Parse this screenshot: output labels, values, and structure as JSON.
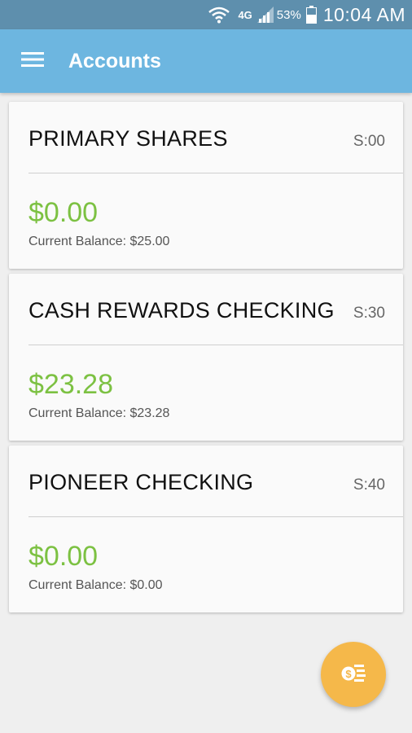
{
  "status_bar": {
    "network": "4G",
    "battery_percent": "53%",
    "time": "10:04 AM"
  },
  "app_bar": {
    "title": "Accounts",
    "menu_icon": "menu-icon",
    "color": "#6db6e0"
  },
  "accounts": [
    {
      "name": "PRIMARY SHARES",
      "suffix": "S:00",
      "available": "$0.00",
      "current_balance": "Current Balance: $25.00"
    },
    {
      "name": "CASH REWARDS CHECKING",
      "suffix": "S:30",
      "available": "$23.28",
      "current_balance": "Current Balance: $23.28"
    },
    {
      "name": "PIONEER CHECKING",
      "suffix": "S:40",
      "available": "$0.00",
      "current_balance": "Current Balance: $0.00"
    }
  ],
  "fab": {
    "icon": "transfer-money-icon",
    "color": "#f5b84a"
  },
  "colors": {
    "amount": "#7cc142",
    "status_bar": "#5e8fad"
  }
}
